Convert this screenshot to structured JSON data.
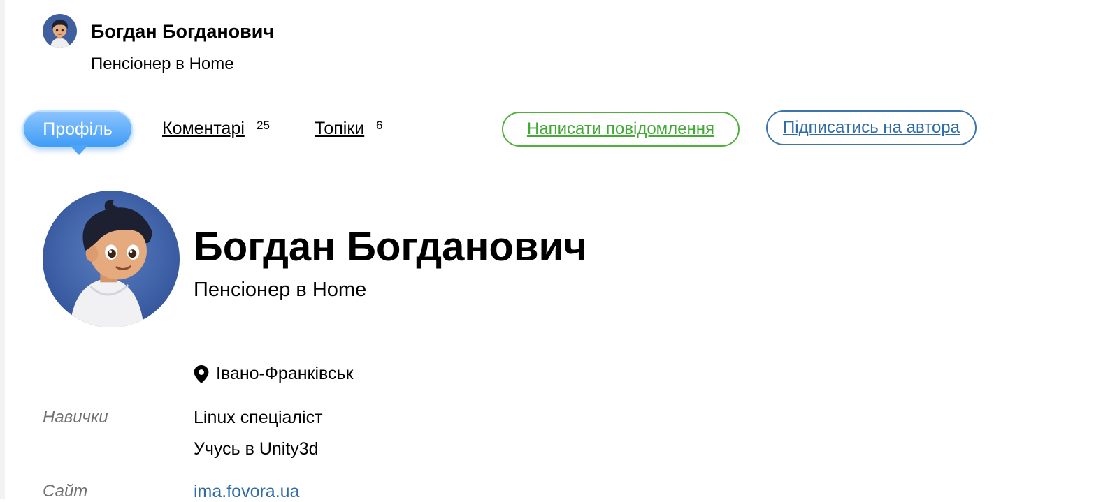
{
  "header": {
    "name": "Богдан Богданович",
    "role": "Пенсіонер в Home"
  },
  "tabs": [
    {
      "label": "Профіль",
      "active": true
    },
    {
      "label": "Коментарі",
      "count": "25"
    },
    {
      "label": "Топіки",
      "count": "6"
    }
  ],
  "actions": {
    "message_label": "Написати повідомлення",
    "subscribe_label": "Підписатись на автора"
  },
  "profile": {
    "name": "Богдан Богданович",
    "role": "Пенсіонер в Home",
    "location": "Івано-Франківськ",
    "skills_label": "Навички",
    "skills": [
      "Linux спеціаліст",
      "Учусь в Unity3d"
    ],
    "site_label": "Сайт",
    "site_value": "ima.fovora.ua"
  },
  "icons": {
    "avatar": "avatar-boy-hoodie",
    "location": "map-pin-icon"
  },
  "colors": {
    "active_tab": "#3f9cf5",
    "message_button": "#4fb13c",
    "subscribe_button": "#3d75a8",
    "muted_label": "#707070"
  }
}
